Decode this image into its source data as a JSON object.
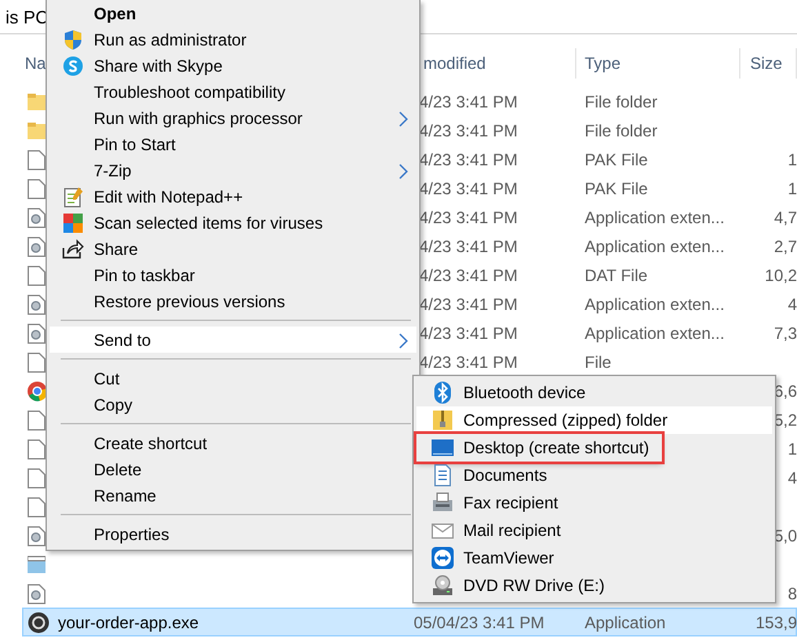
{
  "address_bar": {
    "text": "is PC"
  },
  "file_list": {
    "columns": [
      "Na",
      "modified",
      "Type",
      "Size"
    ],
    "rows": [
      {
        "kind": "folder",
        "date": "4/23 3:41 PM",
        "type": "File folder",
        "selected": false
      },
      {
        "kind": "folder",
        "date": "4/23 3:41 PM",
        "type": "File folder",
        "selected": false
      },
      {
        "kind": "file",
        "date": "4/23 3:41 PM",
        "type": "PAK File",
        "size": "1",
        "selected": false
      },
      {
        "kind": "file",
        "date": "4/23 3:41 PM",
        "type": "PAK File",
        "size": "1",
        "selected": false
      },
      {
        "kind": "library",
        "date": "4/23 3:41 PM",
        "type": "Application exten...",
        "size": "4,7",
        "selected": false
      },
      {
        "kind": "library",
        "date": "4/23 3:41 PM",
        "type": "Application exten...",
        "size": "2,7",
        "selected": false
      },
      {
        "kind": "file",
        "date": "4/23 3:41 PM",
        "type": "DAT File",
        "size": "10,2",
        "selected": false
      },
      {
        "kind": "library",
        "date": "4/23 3:41 PM",
        "type": "Application exten...",
        "size": "4",
        "selected": false
      },
      {
        "kind": "library",
        "date": "4/23 3:41 PM",
        "type": "Application exten...",
        "size": "7,3",
        "selected": false
      },
      {
        "kind": "file",
        "date": "4/23 3:41 PM",
        "type": "File",
        "selected": false
      },
      {
        "kind": "browser",
        "size": "6,6",
        "selected": false
      },
      {
        "kind": "file",
        "size": "5,2",
        "selected": false
      },
      {
        "kind": "file",
        "size": "1",
        "selected": false
      },
      {
        "kind": "file",
        "size": "4",
        "selected": false
      },
      {
        "kind": "file",
        "selected": false
      },
      {
        "kind": "library",
        "size": "5,0",
        "selected": false
      },
      {
        "kind": "notes",
        "selected": false
      },
      {
        "kind": "library",
        "size": "8",
        "selected": false
      },
      {
        "kind": "app",
        "name": "your-order-app.exe",
        "date": "05/04/23 3:41 PM",
        "type": "Application",
        "size": "153,9",
        "selected": true
      }
    ]
  },
  "context_menu": {
    "items": [
      {
        "kind": "item",
        "label": "Open",
        "default": true,
        "selected": false
      },
      {
        "kind": "item",
        "label": "Run as administrator",
        "selected": false
      },
      {
        "kind": "item",
        "label": "Share with Skype",
        "selected": false
      },
      {
        "kind": "item",
        "label": "Troubleshoot compatibility",
        "selected": false
      },
      {
        "kind": "item",
        "label": "Run with graphics processor",
        "submenu": true,
        "selected": false
      },
      {
        "kind": "item",
        "label": "Pin to Start",
        "selected": false
      },
      {
        "kind": "item",
        "label": "7-Zip",
        "submenu": true,
        "selected": false
      },
      {
        "kind": "item",
        "label": "Edit with Notepad++",
        "selected": false
      },
      {
        "kind": "item",
        "label": "Scan selected items for viruses",
        "selected": false
      },
      {
        "kind": "item",
        "label": "Share",
        "selected": false
      },
      {
        "kind": "item",
        "label": "Pin to taskbar",
        "selected": false
      },
      {
        "kind": "item",
        "label": "Restore previous versions",
        "selected": false
      },
      {
        "kind": "separator"
      },
      {
        "kind": "item",
        "label": "Send to",
        "submenu": true,
        "selected": true
      },
      {
        "kind": "separator"
      },
      {
        "kind": "item",
        "label": "Cut",
        "selected": false
      },
      {
        "kind": "item",
        "label": "Copy",
        "selected": false
      },
      {
        "kind": "separator"
      },
      {
        "kind": "item",
        "label": "Create shortcut",
        "selected": false
      },
      {
        "kind": "item",
        "label": "Delete",
        "selected": false
      },
      {
        "kind": "item",
        "label": "Rename",
        "selected": false
      },
      {
        "kind": "separator"
      },
      {
        "kind": "item",
        "label": "Properties",
        "selected": false
      }
    ]
  },
  "send_to_menu": {
    "items": [
      {
        "label": "Bluetooth device",
        "selected": false,
        "marked": false
      },
      {
        "label": "Compressed (zipped) folder",
        "selected": true,
        "marked": false
      },
      {
        "label": "Desktop (create shortcut)",
        "selected": false,
        "marked": true
      },
      {
        "label": "Documents",
        "selected": false,
        "marked": false
      },
      {
        "label": "Fax recipient",
        "selected": false,
        "marked": false
      },
      {
        "label": "Mail recipient",
        "selected": false,
        "marked": false
      },
      {
        "label": "TeamViewer",
        "selected": false,
        "marked": false
      },
      {
        "label": "DVD RW Drive (E:)",
        "selected": false,
        "marked": false
      }
    ]
  }
}
